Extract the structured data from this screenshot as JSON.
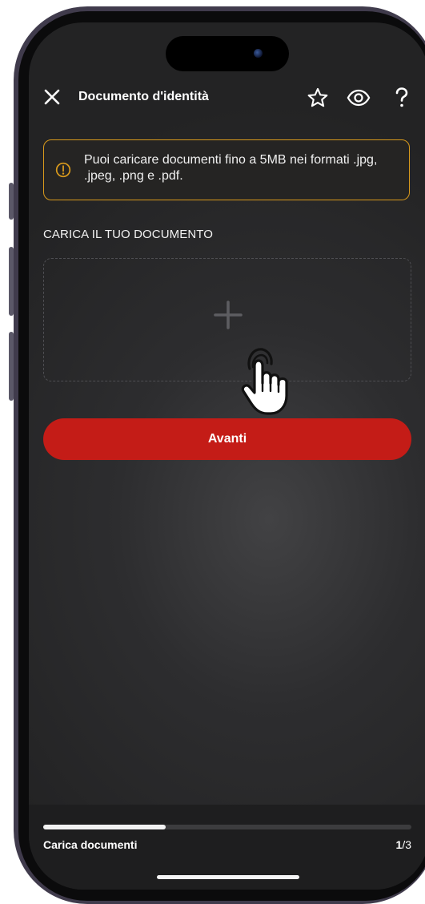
{
  "header": {
    "title": "Documento d'identità",
    "close_icon": "close-icon",
    "favorite_icon": "star-icon",
    "view_icon": "eye-icon",
    "help_icon": "question-mark-icon"
  },
  "banner": {
    "text": "Puoi caricare documenti fino a 5MB nei formati .jpg, .jpeg, .png e .pdf.",
    "icon": "info-circle-icon",
    "border_color": "#d99a1c"
  },
  "upload": {
    "section_label": "CARICA IL TUO DOCUMENTO",
    "icon": "plus-icon",
    "pointer_icon": "hand-pointer-icon"
  },
  "actions": {
    "next_label": "Avanti",
    "next_color": "#c41c17"
  },
  "progress": {
    "step_label": "Carica documenti",
    "current_step": "1",
    "step_separator": "/",
    "total_steps": "3",
    "fraction": 0.333
  }
}
